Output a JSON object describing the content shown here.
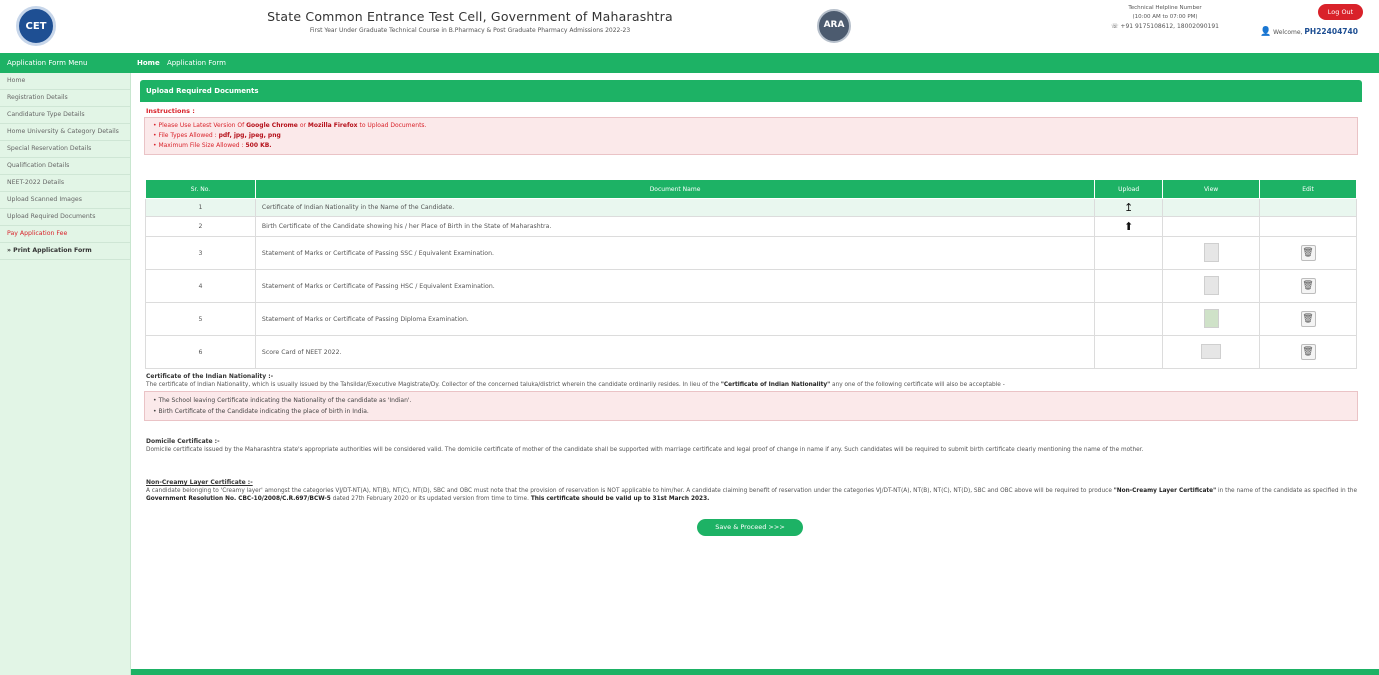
{
  "header": {
    "logo_left": "CET",
    "title": "State Common Entrance Test Cell, Government of Maharashtra",
    "subtitle": "First Year Under Graduate Technical Course in B.Pharmacy & Post Graduate Pharmacy Admissions 2022-23",
    "logo_mid": "ARA",
    "helpline_title": "Technical Helpline Number",
    "helpline_hours": "(10:00 AM to 07:00 PM)",
    "helpline_phone": "+91 9175108612, 18002090191",
    "logout_label": "Log Out",
    "welcome_label": "Welcome,",
    "application_id": "PH22404740"
  },
  "sidebar": {
    "title": "Application Form Menu",
    "items": [
      {
        "label": "Home"
      },
      {
        "label": "Registration Details"
      },
      {
        "label": "Candidature Type Details"
      },
      {
        "label": "Home University & Category Details"
      },
      {
        "label": "Special Reservation Details"
      },
      {
        "label": "Qualification Details"
      },
      {
        "label": "NEET-2022 Details"
      },
      {
        "label": "Upload Scanned Images"
      },
      {
        "label": "Upload Required Documents"
      },
      {
        "label": "Pay Application Fee"
      },
      {
        "label": "Print Application Form"
      }
    ]
  },
  "breadcrumb": {
    "home": "Home",
    "current": "Application Form"
  },
  "panel": {
    "title": "Upload Required Documents",
    "instructions_title": "Instructions :",
    "instructions": {
      "line1_prefix": "Please Use Latest Version Of",
      "browser1": "Google Chrome",
      "line1_or": "or",
      "browser2": "Mozilla Firefox",
      "line1_suffix": "to Upload Documents.",
      "line2_prefix": "File Types Allowed :",
      "file_types": "pdf, jpg, jpeg, png",
      "line3_prefix": "Maximum File Size Allowed :",
      "max_size": "500 KB."
    }
  },
  "table": {
    "headers": [
      "Sr. No.",
      "Document Name",
      "Upload",
      "View",
      "Edit"
    ],
    "rows": [
      {
        "sr": "1",
        "name": "Certificate of Indian Nationality in the Name of the Candidate.",
        "upload_icon": "↥",
        "has_view": false,
        "has_edit": false
      },
      {
        "sr": "2",
        "name": "Birth Certificate of the Candidate showing his / her Place of Birth in the State of Maharashtra.",
        "upload_icon": "⬆",
        "has_view": false,
        "has_edit": false
      },
      {
        "sr": "3",
        "name": "Statement of Marks or Certificate of Passing SSC / Equivalent Examination.",
        "upload_icon": "",
        "has_view": true,
        "has_edit": true
      },
      {
        "sr": "4",
        "name": "Statement of Marks or Certificate of Passing HSC / Equivalent Examination.",
        "upload_icon": "",
        "has_view": true,
        "has_edit": true
      },
      {
        "sr": "5",
        "name": "Statement of Marks or Certificate of Passing Diploma Examination.",
        "upload_icon": "",
        "has_view": true,
        "has_edit": true
      },
      {
        "sr": "6",
        "name": "Score Card of NEET 2022.",
        "upload_icon": "",
        "has_view": true,
        "has_edit": true
      }
    ],
    "trash_glyph": "🗑"
  },
  "notes": {
    "nationality_title": "Certificate of the Indian Nationality :-",
    "nationality_text_prefix": "The certificate of Indian Nationality, which is usually issued by the Tahsildar/Executive Magistrate/Dy. Collector of the concerned taluka/district wherein the candidate ordinarily resides. In lieu of the",
    "nationality_cert_name": "\"Certificate of Indian Nationality\"",
    "nationality_text_suffix": "any one of the following certificate will also be acceptable -",
    "nationality_items": [
      "The School leaving Certificate indicating the Nationality of the candidate as 'Indian'.",
      "Birth Certificate of the Candidate indicating the place of birth in India."
    ],
    "domicile_title": "Domicile Certificate :-",
    "domicile_text": "Domicile certificate issued by the Maharashtra state's appropriate authorities will be considered valid. The domicile certificate of mother of the candidate shall be supported with marriage certificate and legal proof of change in name if any. Such candidates will be required to submit birth certificate clearly mentioning the name of the mother.",
    "noncreamy_title": "Non-Creamy Layer Certificate :-",
    "noncreamy_text_prefix": "A candidate belonging to 'Creamy layer' amongst the categories VJ/DT-NT(A), NT(B), NT(C), NT(D), SBC and OBC must note that the provision of reservation is NOT applicable to him/her. A candidate claiming benefit of reservation under the categories VJ/DT-NT(A), NT(B), NT(C), NT(D), SBC and OBC above will be required to produce",
    "noncreamy_cert_name": "\"Non-Creamy Layer Certificate\"",
    "noncreamy_text_mid": "in the name of the candidate as specified in the",
    "noncreamy_gr": "Government Resolution No. CBC-10/2008/C.R.697/BCW-5",
    "noncreamy_text_mid2": "dated 27th February 2020 or its updated version from time to time.",
    "noncreamy_validity": "This certificate should be valid up to 31st March 2023."
  },
  "actions": {
    "save_label": "Save & Proceed >>>"
  },
  "colors": {
    "accent_green": "#1db265",
    "alert_red": "#d9222a",
    "brand_blue": "#1e4f93"
  }
}
